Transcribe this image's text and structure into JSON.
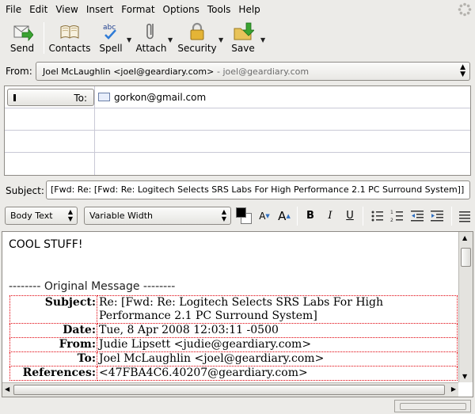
{
  "menu": [
    "File",
    "Edit",
    "View",
    "Insert",
    "Format",
    "Options",
    "Tools",
    "Help"
  ],
  "toolbar": {
    "send": "Send",
    "contacts": "Contacts",
    "spell": "Spell",
    "attach": "Attach",
    "security": "Security",
    "save": "Save",
    "spell_icon_text": "abc"
  },
  "from": {
    "label": "From:",
    "identity": "Joel McLaughlin <joel@geardiary.com>",
    "account": "- joel@geardiary.com"
  },
  "recipients": [
    {
      "type": "To:",
      "address": "gorkon@gmail.com"
    }
  ],
  "subject": {
    "label": "Subject:",
    "value": "[Fwd: Re: [Fwd: Re: Logitech Selects SRS Labs For High Performance 2.1 PC Surround System]]"
  },
  "format": {
    "paragraph": "Body Text",
    "font": "Variable Width",
    "text_color": "#000000",
    "background_color": "#ffffff"
  },
  "body": {
    "first_line": "COOL STUFF!",
    "separator": "-------- Original Message --------",
    "headers": [
      {
        "key": "Subject:",
        "value": "Re: [Fwd: Re: Logitech Selects SRS Labs For High Performance 2.1 PC Surround System]"
      },
      {
        "key": "Date:",
        "value": "Tue, 8 Apr 2008 12:03:11 -0500"
      },
      {
        "key": "From:",
        "value": "Judie Lipsett <judie@geardiary.com>"
      },
      {
        "key": "To:",
        "value": "Joel McLaughlin <joel@geardiary.com>"
      },
      {
        "key": "References:",
        "value": "<47FBA4C6.40207@geardiary.com>"
      }
    ]
  }
}
